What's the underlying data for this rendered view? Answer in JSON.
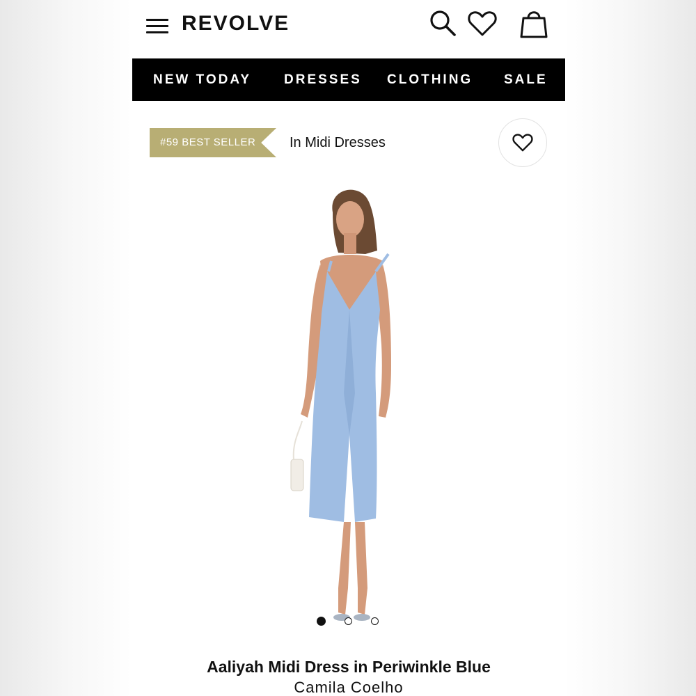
{
  "header": {
    "logo": "REVOLVE",
    "icons": [
      "menu-icon",
      "search-icon",
      "heart-icon",
      "bag-icon"
    ]
  },
  "nav": {
    "items": [
      {
        "label": "NEW TODAY"
      },
      {
        "label": "DRESSES"
      },
      {
        "label": "CLOTHING"
      },
      {
        "label": "SALE"
      }
    ]
  },
  "badge": {
    "label": "#59 BEST SELLER",
    "color": "#b8ae74"
  },
  "category": {
    "label": "In Midi Dresses"
  },
  "product": {
    "title": "Aaliyah Midi Dress in Periwinkle Blue",
    "brand": "Camila Coelho",
    "dress_color": "#9fbde3",
    "image_count": 3,
    "active_image": 1
  }
}
